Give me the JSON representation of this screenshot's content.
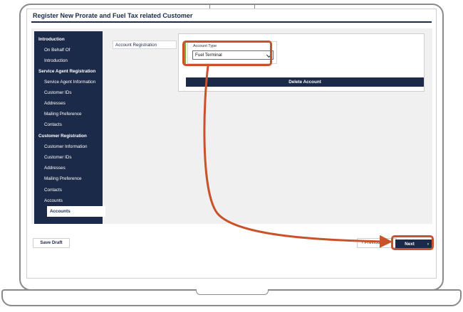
{
  "page": {
    "title": "Register New Prorate and Fuel Tax related Customer"
  },
  "sidebar": {
    "items": [
      {
        "label": "Introduction",
        "kind": "section"
      },
      {
        "label": "On Behalf Of",
        "kind": "sub"
      },
      {
        "label": "Introduction",
        "kind": "sub"
      },
      {
        "label": "Service Agent Registration",
        "kind": "section"
      },
      {
        "label": "Service Agent Information",
        "kind": "sub"
      },
      {
        "label": "Customer IDs",
        "kind": "sub"
      },
      {
        "label": "Addresses",
        "kind": "sub"
      },
      {
        "label": "Mailing Preference",
        "kind": "sub"
      },
      {
        "label": "Contacts",
        "kind": "sub"
      },
      {
        "label": "Customer Registration",
        "kind": "section"
      },
      {
        "label": "Customer Information",
        "kind": "sub"
      },
      {
        "label": "Customer IDs",
        "kind": "sub"
      },
      {
        "label": "Addresses",
        "kind": "sub"
      },
      {
        "label": "Mailing Preference",
        "kind": "sub"
      },
      {
        "label": "Contacts",
        "kind": "sub"
      },
      {
        "label": "Accounts",
        "kind": "sub"
      },
      {
        "label": "Accounts",
        "kind": "active"
      }
    ]
  },
  "account_registration": {
    "section_label": "Account Registration",
    "field_label": "Account Type",
    "selected_value": "Fuel Terminal",
    "delete_button": "Delete Account"
  },
  "footer": {
    "save_draft": "Save Draft",
    "previous": "Previous",
    "previous_icon": "chevron-left-icon",
    "next": "Next",
    "next_icon": "chevron-right-icon"
  },
  "colors": {
    "navy": "#1b2a48",
    "highlight": "#c9522a",
    "accent_green": "#6cb33f"
  }
}
